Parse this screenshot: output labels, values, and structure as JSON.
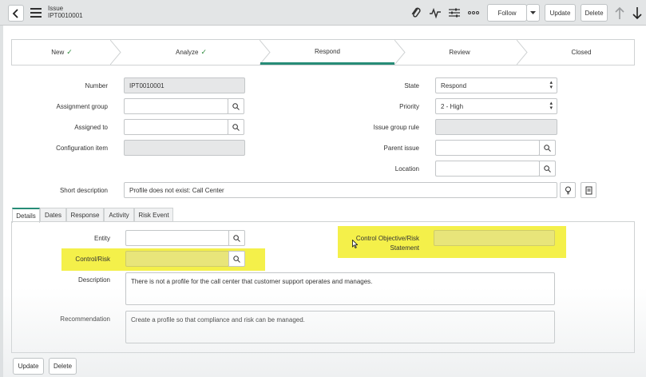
{
  "header": {
    "record_type": "Issue",
    "record_number": "IPT0010001",
    "back_icon": "chevron-left-icon",
    "menu_icon": "hamburger-icon",
    "icons": [
      "paperclip-icon",
      "activity-icon",
      "sliders-icon",
      "more-icon"
    ],
    "follow_label": "Follow",
    "update_label": "Update",
    "delete_label": "Delete"
  },
  "flow": {
    "stages": [
      {
        "label": "New",
        "done": true
      },
      {
        "label": "Analyze",
        "done": true
      },
      {
        "label": "Respond",
        "active": true
      },
      {
        "label": "Review"
      },
      {
        "label": "Closed"
      }
    ],
    "check": "✓"
  },
  "form": {
    "number_label": "Number",
    "number_value": "IPT0010001",
    "assignment_group_label": "Assignment group",
    "assignment_group_value": "",
    "assigned_to_label": "Assigned to",
    "assigned_to_value": "",
    "configuration_item_label": "Configuration item",
    "configuration_item_value": "",
    "state_label": "State",
    "state_value": "Respond",
    "priority_label": "Priority",
    "priority_value": "2 - High",
    "issue_group_rule_label": "Issue group rule",
    "parent_issue_label": "Parent issue",
    "location_label": "Location",
    "short_description_label": "Short description",
    "short_description_value": "Profile does not exist: Call Center"
  },
  "tabs": [
    "Details",
    "Dates",
    "Response",
    "Activity",
    "Risk Event"
  ],
  "details": {
    "entity_label": "Entity",
    "control_risk_label": "Control/Risk",
    "control_objective_label_1": "Control Objective/Risk",
    "control_objective_label_2": "Statement",
    "description_label": "Description",
    "description_value": "There is not a profile for the call center that customer support operates and manages.",
    "recommendation_label": "Recommendation",
    "recommendation_value": "Create a profile so that compliance and risk can be managed."
  },
  "bottom": {
    "update_label": "Update",
    "delete_label": "Delete"
  },
  "colors": {
    "accent": "#278c77",
    "highlight": "#f4f04a",
    "check": "#2e8b3d"
  }
}
